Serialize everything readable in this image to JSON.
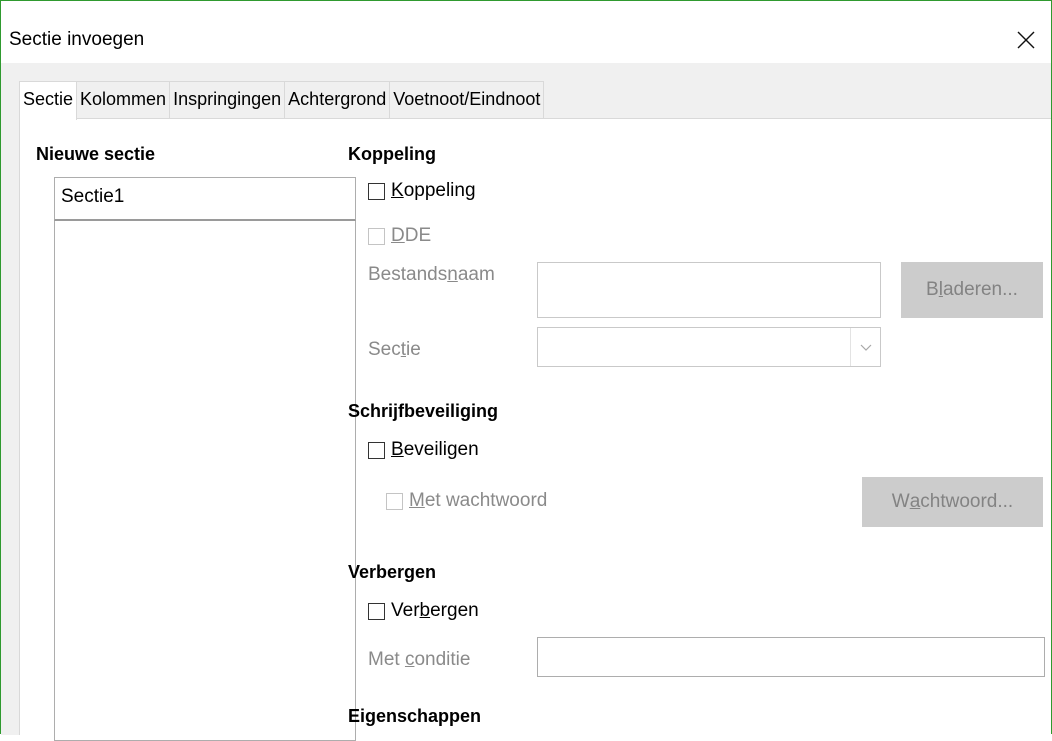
{
  "window": {
    "title": "Sectie invoegen"
  },
  "tabs": [
    {
      "label": "Sectie",
      "active": true
    },
    {
      "label": "Kolommen"
    },
    {
      "label": "Inspringingen"
    },
    {
      "label": "Achtergrond"
    },
    {
      "label": "Voetnoot/Eindnoot"
    }
  ],
  "new_section": {
    "heading": "Nieuwe sectie",
    "name_value": "Sectie1"
  },
  "link": {
    "heading": "Koppeling",
    "link_checkbox": {
      "label_pre": "",
      "label_ul": "K",
      "label_post": "oppeling",
      "checked": false
    },
    "dde_checkbox": {
      "label_pre": "",
      "label_ul": "D",
      "label_post": "DE",
      "checked": false,
      "disabled": true
    },
    "filename_label": {
      "pre": "Bestands",
      "ul": "n",
      "post": "aam"
    },
    "browse_button": {
      "pre": "B",
      "ul": "l",
      "post": "aderen..."
    },
    "section_label": {
      "pre": "Sec",
      "ul": "t",
      "post": "ie"
    },
    "section_value": ""
  },
  "write_protection": {
    "heading": "Schrijfbeveiliging",
    "protect_checkbox": {
      "label_pre": "",
      "label_ul": "B",
      "label_post": "eveiligen",
      "checked": false
    },
    "password_checkbox": {
      "label_pre": "",
      "label_ul": "M",
      "label_post": "et wachtwoord",
      "checked": false,
      "disabled": true
    },
    "password_button": {
      "pre": "W",
      "ul": "a",
      "post": "chtwoord..."
    }
  },
  "hide": {
    "heading": "Verbergen",
    "hide_checkbox": {
      "label_pre": "Ver",
      "label_ul": "b",
      "label_post": "ergen",
      "checked": false
    },
    "condition_label": {
      "pre": "Met ",
      "ul": "c",
      "post": "onditie"
    },
    "condition_value": ""
  },
  "properties": {
    "heading": "Eigenschappen"
  },
  "icons": {
    "close": "close-icon",
    "dropdown": "chevron-down-icon"
  }
}
